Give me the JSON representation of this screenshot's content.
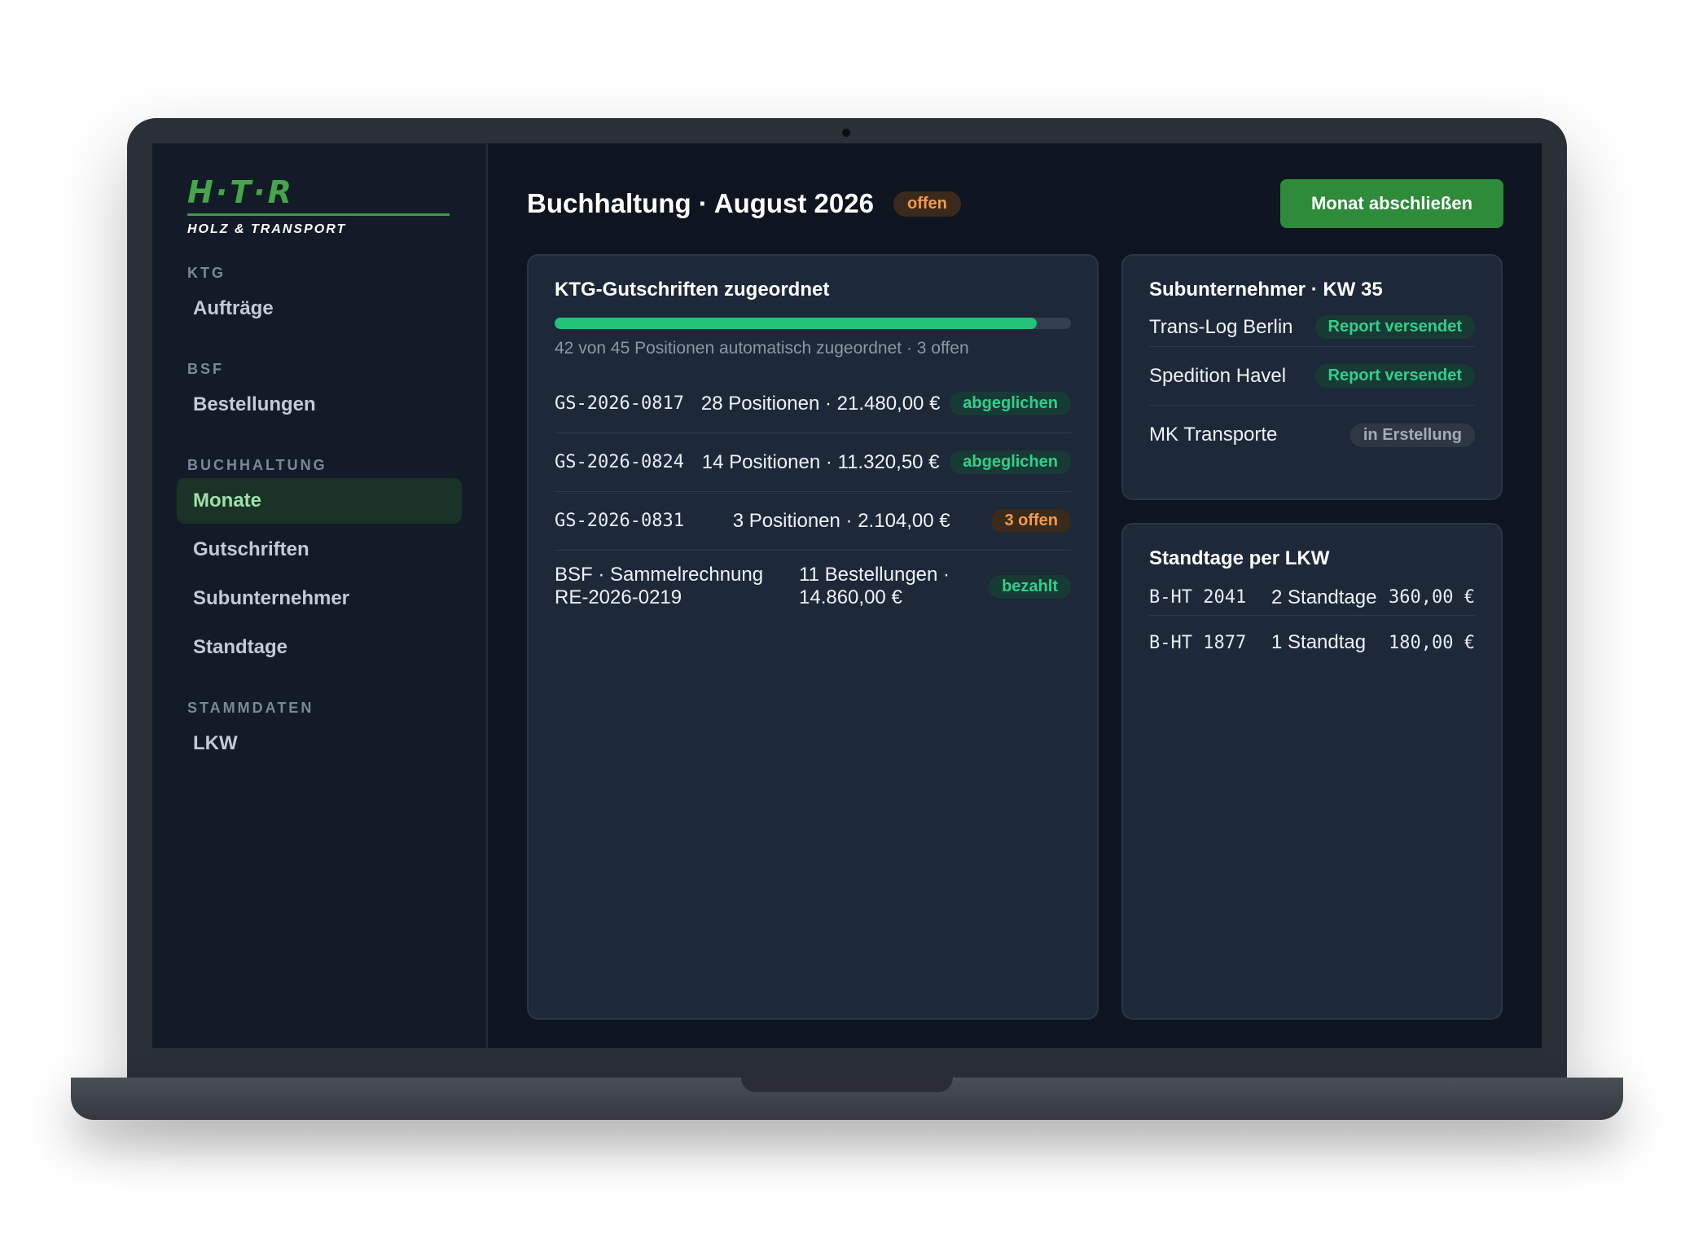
{
  "brand": {
    "mark": "H·T·R",
    "sub": "HOLZ & TRANSPORT"
  },
  "sidebar": {
    "sections": [
      {
        "label": "KTG",
        "items": [
          {
            "label": "Aufträge"
          }
        ]
      },
      {
        "label": "BSF",
        "items": [
          {
            "label": "Bestellungen"
          }
        ]
      },
      {
        "label": "BUCHHALTUNG",
        "items": [
          {
            "label": "Monate",
            "active": true
          },
          {
            "label": "Gutschriften"
          },
          {
            "label": "Subunternehmer"
          },
          {
            "label": "Standtage"
          }
        ]
      },
      {
        "label": "STAMMDATEN",
        "items": [
          {
            "label": "LKW"
          }
        ]
      }
    ]
  },
  "header": {
    "title": "Buchhaltung · August 2026",
    "status": "offen",
    "action": "Monat abschließen"
  },
  "ktg": {
    "title": "KTG-Gutschriften zugeordnet",
    "progress_fraction": 0.933,
    "caption": "42 von 45 Positionen automatisch zugeordnet · 3 offen",
    "rows": [
      {
        "id": "GS-2026-0817",
        "desc": "28 Positionen · 21.480,00 €",
        "badge": "abgeglichen"
      },
      {
        "id": "GS-2026-0824",
        "desc": "14 Positionen · 11.320,50 €",
        "badge": "abgeglichen"
      },
      {
        "id": "GS-2026-0831",
        "desc": "3 Positionen · 2.104,00 €",
        "badge": "3 offen"
      },
      {
        "id": "BSF · Sammelrechnung RE-2026-0219",
        "desc": "11 Bestellungen · 14.860,00 €",
        "badge": "bezahlt"
      }
    ]
  },
  "subs": {
    "title": "Subunternehmer · KW 35",
    "rows": [
      {
        "name": "Trans-Log Berlin",
        "badge": "Report versendet"
      },
      {
        "name": "Spedition Havel",
        "badge": "Report versendet"
      },
      {
        "name": "MK Transporte",
        "badge": "in Erstellung"
      }
    ]
  },
  "standtage": {
    "title": "Standtage per LKW",
    "rows": [
      {
        "plate": "B-HT 2041",
        "days": "2 Standtage",
        "amount": "360,00 €"
      },
      {
        "plate": "B-HT 1877",
        "days": "1 Standtag",
        "amount": "180,00 €"
      }
    ]
  },
  "colors": {
    "accent": "#2e8b3a",
    "progress": "#22c47a",
    "ok": "#2fd08a",
    "warn": "#f39a49"
  }
}
